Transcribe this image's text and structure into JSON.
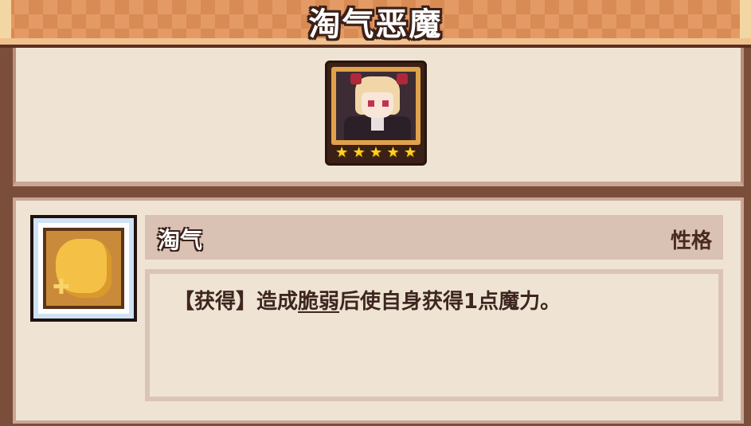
{
  "header": {
    "title": "淘气恶魔"
  },
  "character": {
    "portrait_icon": "demon-girl-portrait",
    "stars": 5,
    "star_glyph": "★"
  },
  "trait": {
    "icon": "gold-skill-icon",
    "name": "淘气",
    "type": "性格",
    "desc_prefix": "【获得】造成",
    "desc_keyword": "脆弱",
    "desc_suffix": "后使自身获得1点魔力。"
  },
  "colors": {
    "banner": "#d98b55",
    "panel_bg": "#efe4d4",
    "frame": "#7a4e3a",
    "star": "#ffd21f"
  }
}
